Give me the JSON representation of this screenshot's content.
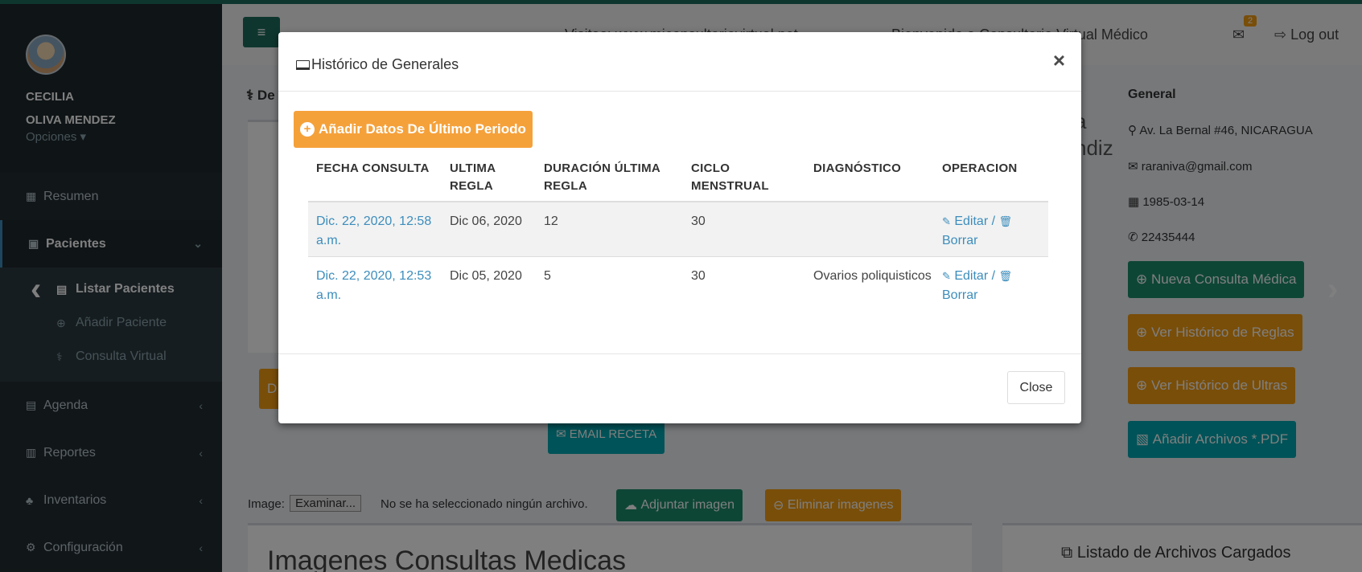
{
  "header": {
    "menu_icon": "≡",
    "visits_text": "Visitas: www.miconsultoriovirtual.net",
    "welcome_text": "Bienvenido a Consultorio Virtual Médico",
    "mail_count": "2",
    "logout_label": "Log out"
  },
  "sidebar": {
    "user_first": "CECILIA",
    "user_last": "OLIVA MENDEZ",
    "options_label": "Opciones ▾",
    "items": [
      {
        "label": "Resumen",
        "icon": "▦"
      },
      {
        "label": "Pacientes",
        "icon": "▣"
      },
      {
        "label": "Agenda",
        "icon": "▤"
      },
      {
        "label": "Reportes",
        "icon": "▥"
      },
      {
        "label": "Inventarios",
        "icon": "♣"
      },
      {
        "label": "Configuración",
        "icon": "⚙"
      }
    ],
    "sub_items": [
      {
        "label": "Listar Pacientes",
        "icon": "▤"
      },
      {
        "label": "Añadir Paciente",
        "icon": "⊕"
      },
      {
        "label": "Consulta Virtual",
        "icon": "⚕"
      }
    ]
  },
  "background": {
    "section_label": "De",
    "name_partial_1": "a",
    "name_partial_2": "ndiz",
    "general_title": "General",
    "address": "Av. La Bernal #46, NICARAGUA",
    "email": "raraniva@gmail.com",
    "dob": "1985-03-14",
    "phone": "22435444",
    "new_consult_btn": "Nueva Consulta Médica",
    "rules_history_btn": "Ver Histórico de Reglas",
    "ultras_history_btn": "Ver Histórico de Ultras",
    "add_pdf_btn": "Añadir Archivos *.PDF",
    "email_recipe_btn": "EMAIL RECETA",
    "image_label": "Image:",
    "browse_btn": "Examinar...",
    "no_file_text": "No se ha seleccionado ningún archivo.",
    "attach_btn": "Adjuntar imagen",
    "delete_images_btn": "Eliminar imagenes",
    "images_title": "Imagenes Consultas Medicas",
    "files_title": "Listado de Archivos Cargados",
    "left_btn_initial": "D"
  },
  "modal": {
    "title": "Histórico de Generales",
    "close_x": "×",
    "add_button": "Añadir Datos De Último Periodo",
    "columns": [
      "FECHA CONSULTA",
      "ULTIMA REGLA",
      "DURACIÓN ÚLTIMA REGLA",
      "CICLO MENSTRUAL",
      "DIAGNÓSTICO",
      "OPERACION"
    ],
    "rows": [
      {
        "fecha": "Dic. 22, 2020, 12:58 a.m.",
        "ultima": "Dic 06, 2020",
        "duracion": "12",
        "ciclo": "30",
        "diagnostico": "",
        "editar": "Editar /",
        "borrar": "Borrar"
      },
      {
        "fecha": "Dic. 22, 2020, 12:53 a.m.",
        "ultima": "Dic 05, 2020",
        "duracion": "5",
        "ciclo": "30",
        "diagnostico": "Ovarios poliquisticos",
        "editar": "Editar /",
        "borrar": "Borrar"
      }
    ],
    "close_button": "Close"
  }
}
